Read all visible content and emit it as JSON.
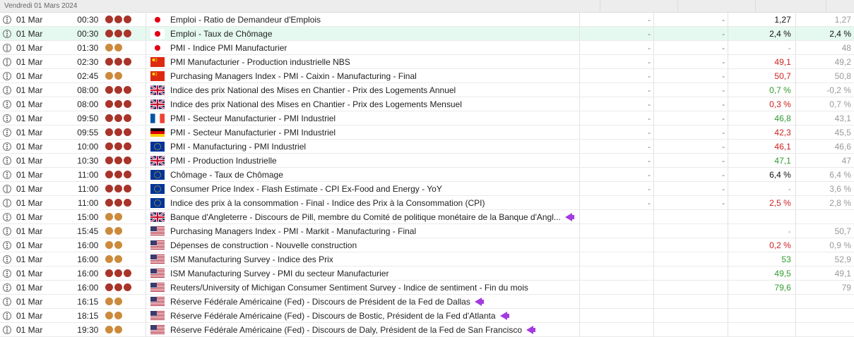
{
  "header": {
    "date": "Vendredi 01 Mars 2024"
  },
  "colors": {
    "high": "#a8342a",
    "medium": "#cc8a3c",
    "red": "#cc1f1f",
    "green": "#2f9a2f",
    "highlight": "#e6f9f1"
  },
  "rows": [
    {
      "date": "01 Mar",
      "time": "00:30",
      "impact": "high",
      "country": "JP",
      "event": "Emploi - Ratio de Demandeur d'Emplois",
      "f1": "-",
      "f2": "-",
      "actual": "1,27",
      "actual_color": "black",
      "previous": "1,27",
      "prev_color": "grey"
    },
    {
      "date": "01 Mar",
      "time": "00:30",
      "impact": "high",
      "country": "JP",
      "event": "Emploi - Taux de Chômage",
      "f1": "-",
      "f2": "-",
      "actual": "2,4 %",
      "actual_color": "black",
      "previous": "2,4 %",
      "prev_color": "dark",
      "highlight": true
    },
    {
      "date": "01 Mar",
      "time": "01:30",
      "impact": "medium",
      "country": "JP",
      "event": "PMI - Indice PMI Manufacturier",
      "f1": "-",
      "f2": "-",
      "actual": "-",
      "actual_color": "grey",
      "previous": "48",
      "prev_color": "grey"
    },
    {
      "date": "01 Mar",
      "time": "02:30",
      "impact": "high",
      "country": "CN",
      "event": "PMI Manufacturier - Production industrielle NBS",
      "f1": "-",
      "f2": "-",
      "actual": "49,1",
      "actual_color": "red",
      "previous": "49,2",
      "prev_color": "grey"
    },
    {
      "date": "01 Mar",
      "time": "02:45",
      "impact": "medium",
      "country": "CN",
      "event": "Purchasing Managers Index - PMI - Caixin - Manufacturing - Final",
      "f1": "-",
      "f2": "-",
      "actual": "50,7",
      "actual_color": "red",
      "previous": "50,8",
      "prev_color": "grey"
    },
    {
      "date": "01 Mar",
      "time": "08:00",
      "impact": "high",
      "country": "GB",
      "event": "Indice des prix National des Mises en Chantier - Prix des Logements Annuel",
      "f1": "-",
      "f2": "-",
      "actual": "0,7 %",
      "actual_color": "green",
      "previous": "-0,2 %",
      "prev_color": "grey"
    },
    {
      "date": "01 Mar",
      "time": "08:00",
      "impact": "high",
      "country": "GB",
      "event": "Indice des prix National des Mises en Chantier - Prix des Logements Mensuel",
      "f1": "-",
      "f2": "-",
      "actual": "0,3 %",
      "actual_color": "red",
      "previous": "0,7 %",
      "prev_color": "grey"
    },
    {
      "date": "01 Mar",
      "time": "09:50",
      "impact": "high",
      "country": "FR",
      "event": "PMI - Secteur Manufacturier - PMI Industriel",
      "f1": "-",
      "f2": "-",
      "actual": "46,8",
      "actual_color": "green",
      "previous": "43,1",
      "prev_color": "grey"
    },
    {
      "date": "01 Mar",
      "time": "09:55",
      "impact": "high",
      "country": "DE",
      "event": "PMI - Secteur Manufacturier - PMI Industriel",
      "f1": "-",
      "f2": "-",
      "actual": "42,3",
      "actual_color": "red",
      "previous": "45,5",
      "prev_color": "grey"
    },
    {
      "date": "01 Mar",
      "time": "10:00",
      "impact": "high",
      "country": "EU",
      "event": "PMI - Manufacturing - PMI Industriel",
      "f1": "-",
      "f2": "-",
      "actual": "46,1",
      "actual_color": "red",
      "previous": "46,6",
      "prev_color": "grey"
    },
    {
      "date": "01 Mar",
      "time": "10:30",
      "impact": "high",
      "country": "GB",
      "event": "PMI - Production Industrielle",
      "f1": "-",
      "f2": "-",
      "actual": "47,1",
      "actual_color": "green",
      "previous": "47",
      "prev_color": "grey"
    },
    {
      "date": "01 Mar",
      "time": "11:00",
      "impact": "high",
      "country": "EU",
      "event": "Chômage - Taux de Chômage",
      "f1": "-",
      "f2": "-",
      "actual": "6,4 %",
      "actual_color": "black",
      "previous": "6,4 %",
      "prev_color": "grey"
    },
    {
      "date": "01 Mar",
      "time": "11:00",
      "impact": "high",
      "country": "EU",
      "event": "Consumer Price Index - Flash Estimate - CPI Ex-Food and Energy - YoY",
      "f1": "-",
      "f2": "-",
      "actual": "-",
      "actual_color": "grey",
      "previous": "3,6 %",
      "prev_color": "grey"
    },
    {
      "date": "01 Mar",
      "time": "11:00",
      "impact": "high",
      "country": "EU",
      "event": "Indice des prix à la consommation - Final - Indice des Prix à la Consommation (CPI)",
      "f1": "-",
      "f2": "-",
      "actual": "2,5 %",
      "actual_color": "red",
      "previous": "2,8 %",
      "prev_color": "grey"
    },
    {
      "date": "01 Mar",
      "time": "15:00",
      "impact": "medium",
      "country": "GB",
      "event": "Banque d'Angleterre - Discours de Pill, membre du Comité de politique monétaire de la Banque d'Angl...",
      "speech": true,
      "f1": "",
      "f2": "",
      "actual": "",
      "actual_color": "grey",
      "previous": "",
      "prev_color": "grey"
    },
    {
      "date": "01 Mar",
      "time": "15:45",
      "impact": "medium",
      "country": "US",
      "event": "Purchasing Managers Index - PMI - Markit - Manufacturing - Final",
      "f1": "",
      "f2": "",
      "actual": "-",
      "actual_color": "grey",
      "previous": "50,7",
      "prev_color": "grey"
    },
    {
      "date": "01 Mar",
      "time": "16:00",
      "impact": "medium",
      "country": "US",
      "event": "Dépenses de construction - Nouvelle construction",
      "f1": "",
      "f2": "",
      "actual": "0,2 %",
      "actual_color": "red",
      "previous": "0,9 %",
      "prev_color": "grey"
    },
    {
      "date": "01 Mar",
      "time": "16:00",
      "impact": "medium",
      "country": "US",
      "event": "ISM Manufacturing Survey - Indice des Prix",
      "f1": "",
      "f2": "",
      "actual": "53",
      "actual_color": "green",
      "previous": "52,9",
      "prev_color": "grey"
    },
    {
      "date": "01 Mar",
      "time": "16:00",
      "impact": "high",
      "country": "US",
      "event": "ISM Manufacturing Survey - PMI du secteur Manufacturier",
      "f1": "",
      "f2": "",
      "actual": "49,5",
      "actual_color": "green",
      "previous": "49,1",
      "prev_color": "grey"
    },
    {
      "date": "01 Mar",
      "time": "16:00",
      "impact": "high",
      "country": "US",
      "event": "Reuters/University of Michigan Consumer Sentiment Survey - Indice de sentiment - Fin du mois",
      "f1": "",
      "f2": "",
      "actual": "79,6",
      "actual_color": "green",
      "previous": "79",
      "prev_color": "grey"
    },
    {
      "date": "01 Mar",
      "time": "16:15",
      "impact": "medium",
      "country": "US",
      "event": "Réserve Fédérale Américaine (Fed) - Discours de Président de la Fed de Dallas",
      "speech": true,
      "f1": "",
      "f2": "",
      "actual": "",
      "actual_color": "grey",
      "previous": "",
      "prev_color": "grey"
    },
    {
      "date": "01 Mar",
      "time": "18:15",
      "impact": "medium",
      "country": "US",
      "event": "Réserve Fédérale Américaine (Fed) - Discours de Bostic, Président de la Fed d'Atlanta",
      "speech": true,
      "f1": "",
      "f2": "",
      "actual": "",
      "actual_color": "grey",
      "previous": "",
      "prev_color": "grey"
    },
    {
      "date": "01 Mar",
      "time": "19:30",
      "impact": "medium",
      "country": "US",
      "event": "Réserve Fédérale Américaine (Fed) - Discours de Daly, Président de la Fed de San Francisco",
      "speech": true,
      "f1": "",
      "f2": "",
      "actual": "",
      "actual_color": "grey",
      "previous": "",
      "prev_color": "grey"
    }
  ]
}
